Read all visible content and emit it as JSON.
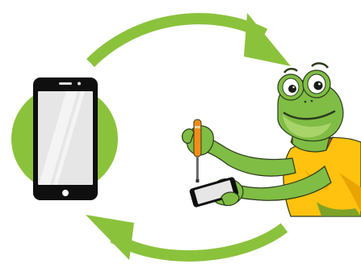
{
  "scene": {
    "description_free": true
  },
  "colors": {
    "arrow_green": "#8BC23C",
    "circle_green": "#8BC23C",
    "phone_body": "#0f0f0f",
    "phone_screen": "#e6e6e6",
    "phone_screen_glare": "#ffffff",
    "frog_skin": "#80BD45",
    "frog_skin_dark": "#5E9A2E",
    "frog_belly": "#A8D46A",
    "shirt_yellow": "#FFC20E",
    "shirt_shadow": "#E9A400",
    "collar": "#D9592A",
    "screwdriver_handle": "#F28C1A",
    "screwdriver_shaft": "#6b6b6b",
    "outline": "#2a3b1a"
  },
  "icons": {
    "top_arrow": "curved-arrow-right",
    "bottom_arrow": "curved-arrow-left",
    "phone": "smartphone-icon",
    "mascot": "frog-repair-mascot",
    "tool": "screwdriver-icon"
  }
}
